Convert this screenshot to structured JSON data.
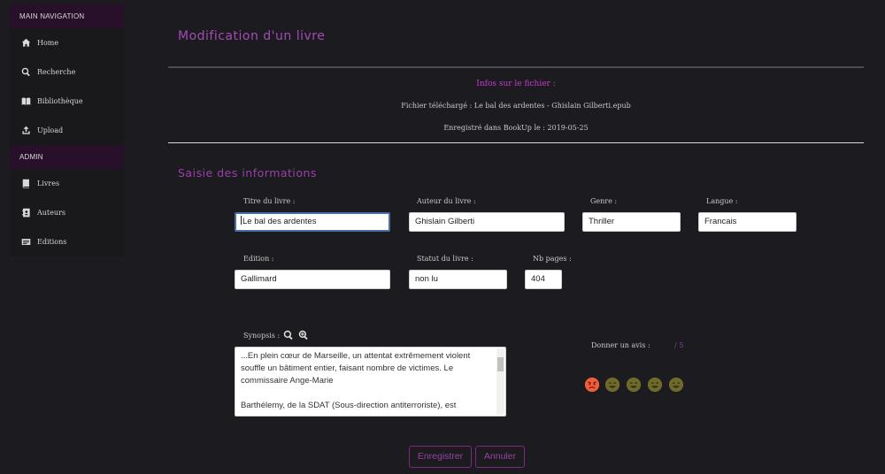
{
  "sidebar": {
    "main_header": "MAIN NAVIGATION",
    "main_items": [
      {
        "label": "Home",
        "icon": "home-icon"
      },
      {
        "label": "Recherche",
        "icon": "search-icon"
      },
      {
        "label": "Bibliothèque",
        "icon": "book-icon"
      },
      {
        "label": "Upload",
        "icon": "upload-icon"
      }
    ],
    "admin_header": "ADMIN",
    "admin_items": [
      {
        "label": "Livres",
        "icon": "book-icon"
      },
      {
        "label": "Auteurs",
        "icon": "address-book-icon"
      },
      {
        "label": "Editions",
        "icon": "id-card-icon"
      }
    ]
  },
  "page": {
    "title": "Modification d'un livre",
    "info_heading": "Infos sur le fichier :",
    "file_line": "Fichier téléchargé : Le bal des ardentes - Ghislain Gilberti.epub",
    "date_line": "Enregistré dans BookUp le : 2019-05-25",
    "form_title": "Saisie des informations"
  },
  "form": {
    "title_label": "Titre du livre :",
    "title_value": "Le bal des ardentes",
    "author_label": "Auteur du livre :",
    "author_value": "Ghislain Gilberti",
    "genre_label": "Genre :",
    "genre_value": "Thriller",
    "language_label": "Langue :",
    "language_value": "Francais",
    "edition_label": "Edition :",
    "edition_value": "Gallimard",
    "status_label": "Statut du livre :",
    "status_value": "non lu",
    "pages_label": "Nb pages :",
    "pages_value": "404",
    "synopsis_label": "Synopsis :",
    "synopsis_value": "...En plein cœur de Marseille, un attentat extrêmement violent souffle un bâtiment entier, faisant nombre de victimes. Le commissaire Ange-Marie\n\nBarthélemy, de la SDAT (Sous-direction antiterroriste), est"
  },
  "rating": {
    "label": "Donner un avis :",
    "value_text": "/ 5",
    "emojis": [
      "angry-face-icon",
      "smile-icon",
      "smile-icon",
      "smile-icon",
      "smile-icon"
    ],
    "colors": {
      "angry": "#f25d3c",
      "neutral": "#6e6a2a"
    }
  },
  "actions": {
    "save": "Enregistrer",
    "cancel": "Annuler"
  },
  "colors": {
    "accent": "#a54ab5",
    "sidebar_header": "#29102a",
    "background": "#1c1c20"
  }
}
